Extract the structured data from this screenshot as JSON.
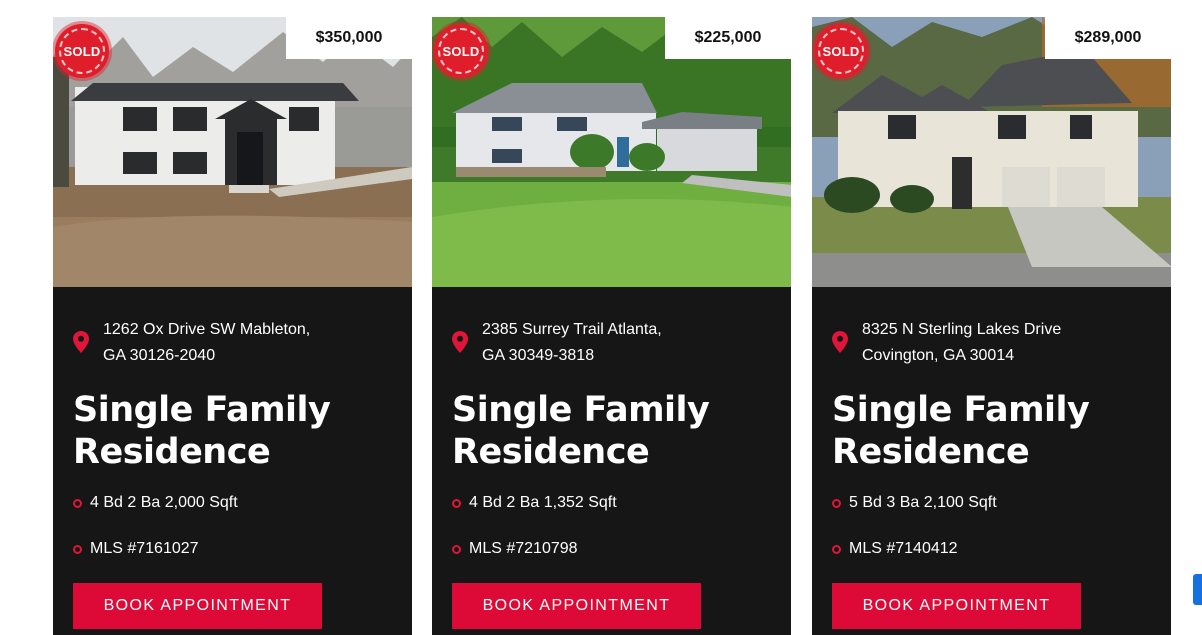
{
  "listings": [
    {
      "price": "$350,000",
      "badge": "SOLD",
      "address_line1": "1262 Ox Drive SW Mableton,",
      "address_line2": "GA 30126-2040",
      "title_line1": "Single Family",
      "title_line2": "Residence",
      "specs": "4 Bd 2 Ba 2,000 Sqft",
      "mls": "MLS #7161027",
      "button": "BOOK APPOINTMENT"
    },
    {
      "price": "$225,000",
      "badge": "SOLD",
      "address_line1": "2385 Surrey Trail Atlanta,",
      "address_line2": "GA 30349-3818",
      "title_line1": "Single Family",
      "title_line2": "Residence",
      "specs": "4 Bd 2 Ba 1,352 Sqft",
      "mls": "MLS #7210798",
      "button": "BOOK APPOINTMENT"
    },
    {
      "price": "$289,000",
      "badge": "SOLD",
      "address_line1": "8325 N Sterling Lakes Drive",
      "address_line2": "Covington, GA 30014",
      "title_line1": "Single Family",
      "title_line2": "Residence",
      "specs": "5 Bd 3 Ba 2,100 Sqft",
      "mls": "MLS #7140412",
      "button": "BOOK APPOINTMENT"
    }
  ],
  "colors": {
    "card_bg": "#161616",
    "accent": "#dd0a37",
    "badge": "#e01e2b",
    "price_bg": "#ffffff"
  },
  "icons": [
    "location-pin-icon",
    "bullet-circle-icon"
  ]
}
